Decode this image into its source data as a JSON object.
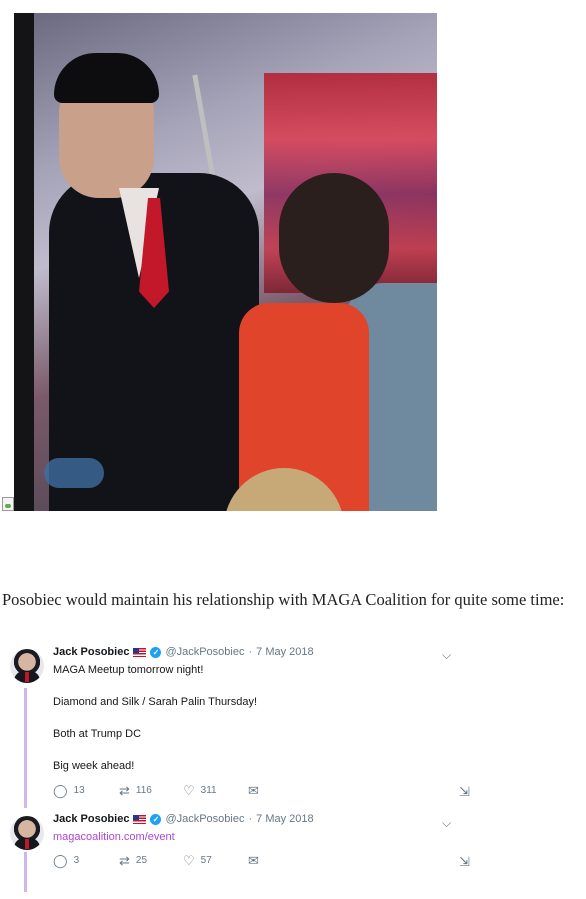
{
  "media": {
    "alt": "video still"
  },
  "article": {
    "paragraph": "Posobiec would maintain his relationship with MAGA Coalition for quite some time:"
  },
  "tweets": [
    {
      "author": "Jack Posobiec",
      "handle": "@JackPosobiec",
      "separator": "·",
      "date": "7 May 2018",
      "lines": [
        "MAGA Meetup tomorrow night!",
        "Diamond and Silk / Sarah Palin Thursday!",
        "Both at Trump DC",
        "Big week ahead!"
      ],
      "replies": "13",
      "retweets": "116",
      "likes": "311"
    },
    {
      "author": "Jack Posobiec",
      "handle": "@JackPosobiec",
      "separator": "·",
      "date": "7 May 2018",
      "link": "magacoalition.com/event",
      "replies": "3",
      "retweets": "25",
      "likes": "57"
    }
  ],
  "icons": {
    "reply": "reply-icon",
    "retweet": "retweet-icon",
    "like": "heart-icon",
    "dm": "mail-icon",
    "share": "share-icon",
    "chevron": "chevron-down-icon",
    "verified": "verified-icon",
    "flag": "us-flag-icon"
  },
  "colors": {
    "link": "#b144d6",
    "thread_line": "#cfb7ee",
    "verified": "#1da1f2",
    "meta": "#657786"
  }
}
